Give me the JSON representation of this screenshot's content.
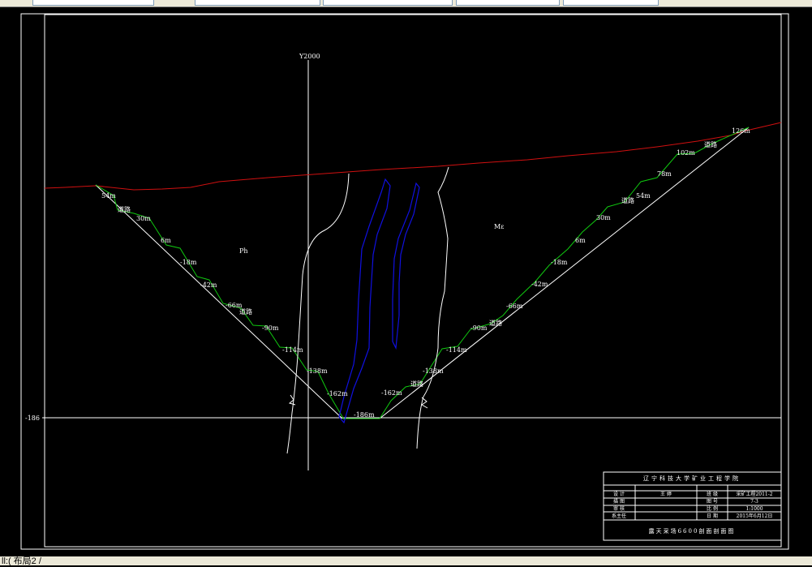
{
  "app": {
    "status_text": "ll:( 布局2 /"
  },
  "drawing": {
    "colors": {
      "ground": "#d01010",
      "bench": "#10c810",
      "geology": "#ffffff",
      "orebody": "#1010e0",
      "frame": "#ffffff"
    },
    "axis_label": "Y2000",
    "level_label": "-186",
    "zones": {
      "left": "Ph",
      "right": "Mε"
    },
    "left_slope_labels": [
      "54m",
      "道路",
      "30m",
      "6m",
      "-18m",
      "-42m",
      "-66m",
      "道路",
      "-90m",
      "-114m",
      "-138m",
      "-162m"
    ],
    "right_slope_labels": [
      "126m",
      "道路",
      "102m",
      "78m",
      "54m",
      "道路",
      "30m",
      "6m",
      "-18m",
      "-42m",
      "-66m",
      "道路",
      "-90m",
      "-114m",
      "-138m",
      "道路",
      "-162m"
    ],
    "bottom_label": "-186m",
    "title_block": {
      "header": "辽宁科技大学矿业工程学院",
      "rows": [
        [
          "设 计",
          "王 婷",
          "班 级",
          "采矿工程2011-2"
        ],
        [
          "描 图",
          "",
          "图 号",
          "7-3"
        ],
        [
          "审 核",
          "",
          "比 例",
          "1:1000"
        ],
        [
          "系主任",
          "",
          "日 期",
          "2015年6月12日"
        ]
      ],
      "title": "露天采场6600剖面剖面图"
    }
  }
}
